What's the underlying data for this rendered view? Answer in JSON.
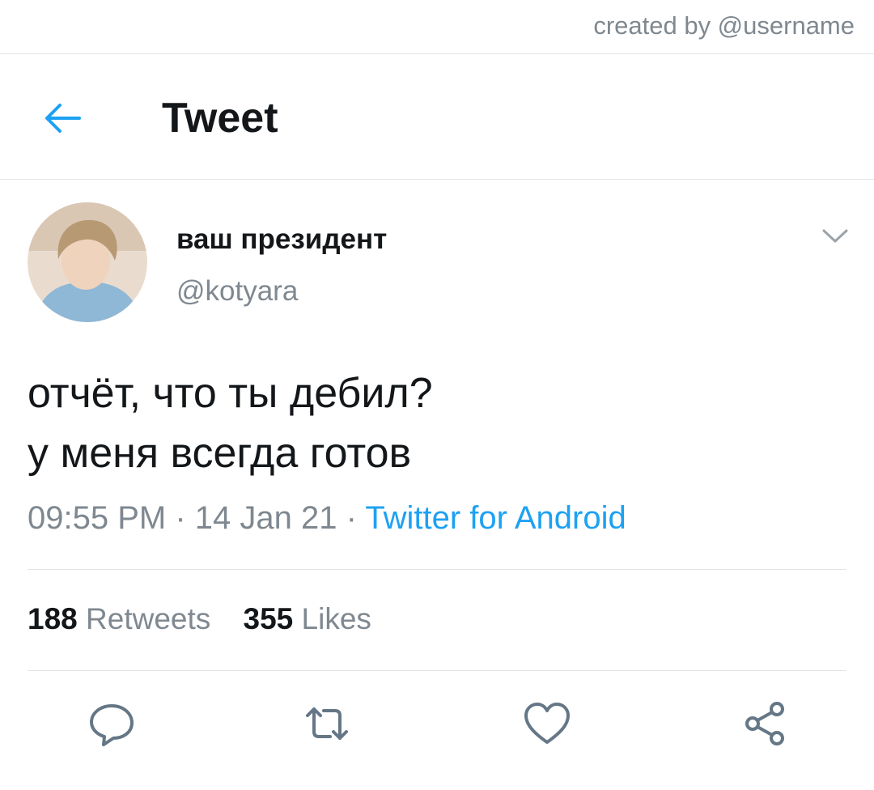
{
  "credit": "created by @username",
  "header": {
    "title": "Tweet",
    "back_icon": "arrow-left-icon",
    "accent_color": "#1da1f2"
  },
  "tweet": {
    "display_name": "ваш президент",
    "handle": "@kotyara",
    "text_lines": [
      "отчёт, что ты дебил?",
      "у меня всегда готов"
    ],
    "time": "09:55 PM",
    "separator": "·",
    "date": "14 Jan 21",
    "source": "Twitter for Android",
    "menu_icon": "chevron-down-icon"
  },
  "stats": {
    "retweets_count": "188",
    "retweets_label": "Retweets",
    "likes_count": "355",
    "likes_label": "Likes"
  },
  "actions": [
    {
      "icon": "reply-icon"
    },
    {
      "icon": "retweet-icon"
    },
    {
      "icon": "heart-icon"
    },
    {
      "icon": "share-icon"
    }
  ],
  "colors": {
    "text": "#14171a",
    "secondary": "#7f8890",
    "link": "#1da1f2",
    "divider": "#e1e5e8"
  }
}
